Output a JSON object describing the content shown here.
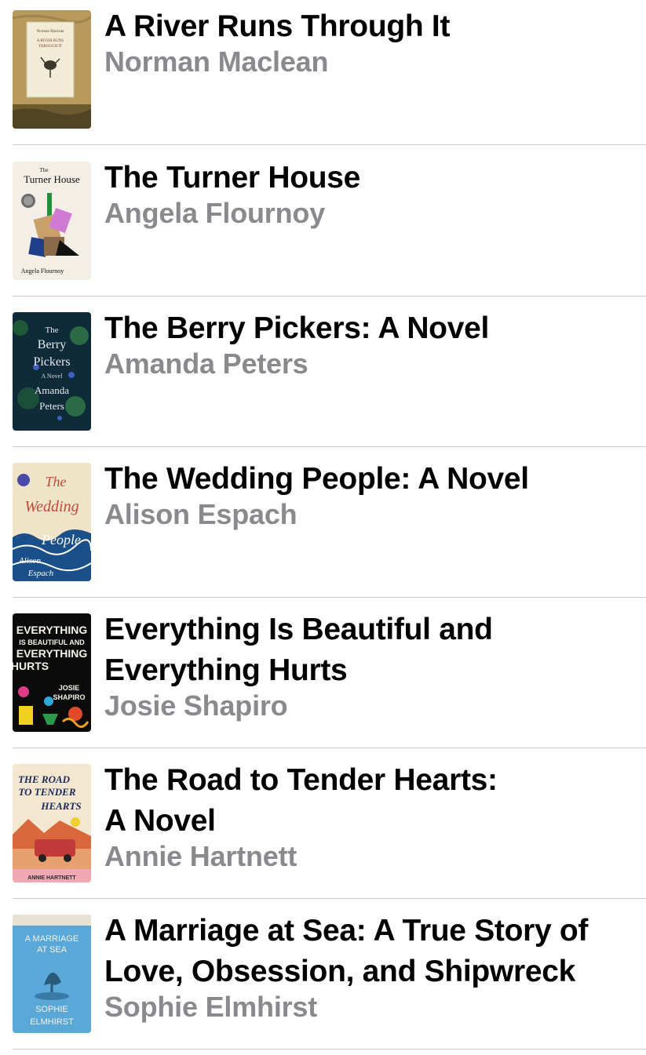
{
  "books": [
    {
      "title": "A River Runs Through It",
      "author": "Norman Maclean",
      "cover": {
        "line1": "A RIVER RUNS",
        "line2": "THROUGH IT",
        "top": "Norman Maclean"
      }
    },
    {
      "title": "The Turner House",
      "author": "Angela Flournoy",
      "cover": {
        "line1": "Turner House",
        "top": "The",
        "bottom": "Angela Flournoy"
      }
    },
    {
      "title": "The Berry Pickers: A Novel",
      "author": "Amanda Peters",
      "cover": {
        "line1": "The",
        "line2": "Berry",
        "line3": "Pickers",
        "line4": "A Novel",
        "line5": "Amanda",
        "line6": "Peters"
      }
    },
    {
      "title": "The Wedding People: A Novel",
      "author": "Alison Espach",
      "cover": {
        "line1": "The",
        "line2": "Wedding",
        "line3": "People",
        "line4": "Alison",
        "line5": "Espach"
      }
    },
    {
      "title": "Everything Is Beautiful and\nEverything Hurts",
      "author": "Josie Shapiro",
      "cover": {
        "line1": "EVERYTHING",
        "line2": "IS BEAUTIFUL AND",
        "line3": "EVERYTHING",
        "line4": "HURTS",
        "line5": "JOSIE",
        "line6": "SHAPIRO"
      }
    },
    {
      "title": "The Road to Tender Hearts:\nA Novel",
      "author": "Annie Hartnett",
      "cover": {
        "line1": "THE ROAD",
        "line2": "TO TENDER",
        "line3": "HEARTS",
        "bottom": "ANNIE HARTNETT"
      }
    },
    {
      "title": "A Marriage at Sea: A True Story of\nLove, Obsession, and Shipwreck",
      "author": "Sophie Elmhirst",
      "cover": {
        "line1": "A MARRIAGE",
        "line2": "AT SEA",
        "line3": "SOPHIE",
        "line4": "ELMHIRST"
      }
    }
  ],
  "colors": {
    "title": "#000000",
    "author": "#8a8a8e",
    "separator": "#cfcfd3"
  }
}
